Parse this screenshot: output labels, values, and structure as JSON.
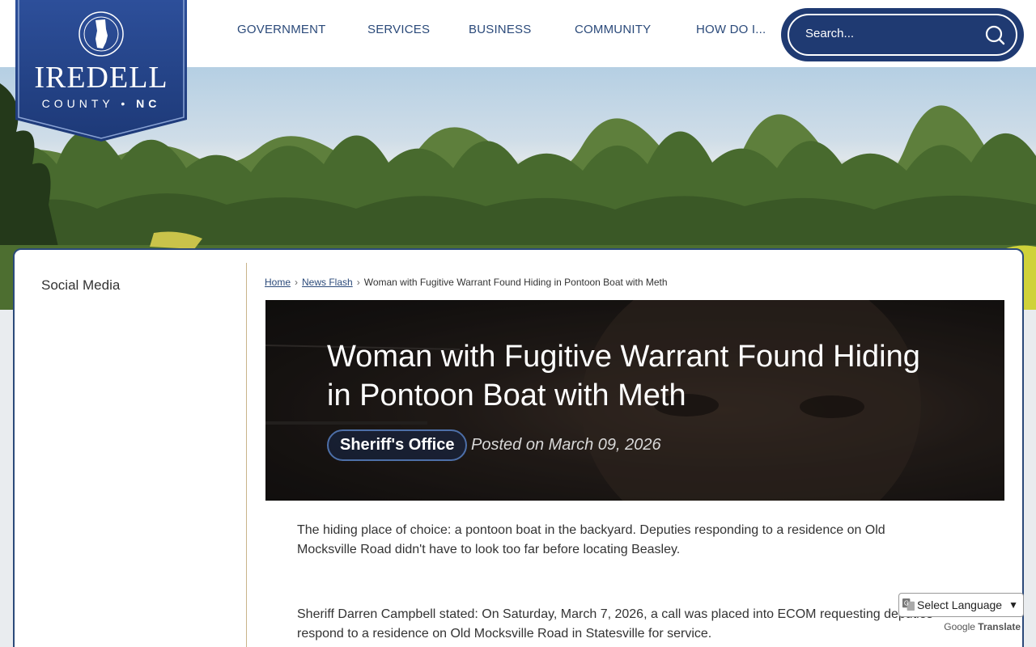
{
  "header": {
    "logo_title": "IREDELL",
    "logo_sub_county": "COUNTY",
    "logo_sub_state": "NC",
    "nav": [
      "GOVERNMENT",
      "SERVICES",
      "BUSINESS",
      "COMMUNITY",
      "HOW DO I..."
    ],
    "search_placeholder": "Search..."
  },
  "sidebar": {
    "title": "Social Media"
  },
  "breadcrumb": {
    "home": "Home",
    "news": "News Flash",
    "current": "Woman with Fugitive Warrant Found Hiding in Pontoon Boat with Meth"
  },
  "article": {
    "title": "Woman with Fugitive Warrant Found Hiding in Pontoon Boat with Meth",
    "category": "Sheriff's Office",
    "posted": "Posted on March 09, 2026",
    "p1": "The hiding place of choice: a pontoon boat in the backyard. Deputies responding to a residence on Old Mocksville Road didn't have to look too far before locating Beasley.",
    "p2": "Sheriff Darren Campbell stated: On Saturday, March 7, 2026, a call was placed into ECOM requesting deputies respond to a residence on Old Mocksville Road in Statesville for service."
  },
  "translate": {
    "select_label": "Select Language",
    "powered_google": "Google",
    "powered_translate": "Translate"
  },
  "colors": {
    "brand_navy": "#1f3a72",
    "nav_text": "#2b4a7a",
    "divider_gold": "#c9b48a"
  }
}
